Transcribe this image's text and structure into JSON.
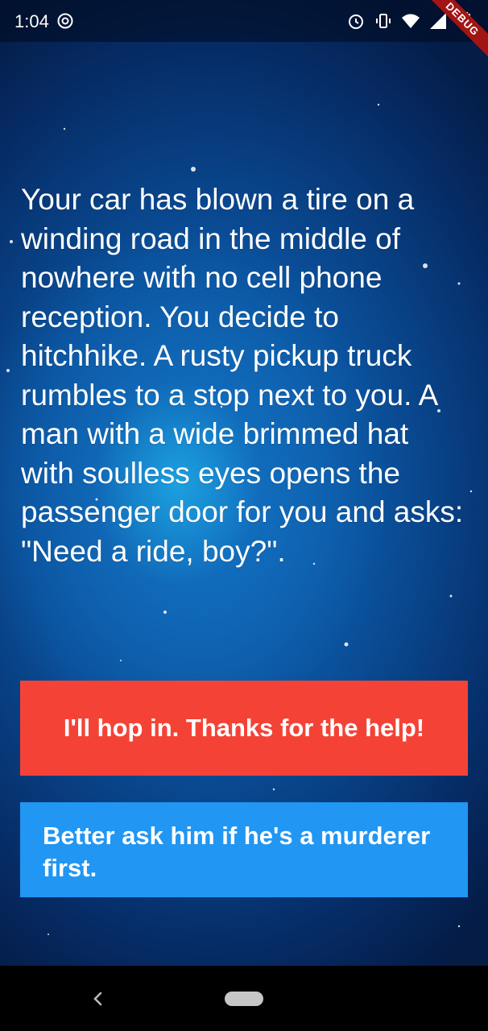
{
  "status_bar": {
    "time": "1:04",
    "left_icon": "data-saver-icon",
    "right_icons": [
      "alarm-icon",
      "vibrate-icon",
      "wifi-icon",
      "signal-icon",
      "battery-charging-icon"
    ],
    "debug_label": "DEBUG"
  },
  "story": {
    "text": "Your car has blown a tire on a winding road in the middle of nowhere with no cell phone reception. You decide to hitchhike. A rusty pickup truck rumbles to a stop next to you. A man with a wide brimmed hat with soulless eyes opens the passenger door for you and asks: \"Need a ride, boy?\"."
  },
  "choices": {
    "choice1_label": "I'll hop in. Thanks for the help!",
    "choice2_label": "Better ask him if he's a murderer first."
  },
  "colors": {
    "choice1": "#f44336",
    "choice2": "#2196f3",
    "debug_banner": "#a31515"
  },
  "nav_bar": {
    "back_icon": "back-chevron-icon",
    "home_icon": "home-pill-icon"
  }
}
